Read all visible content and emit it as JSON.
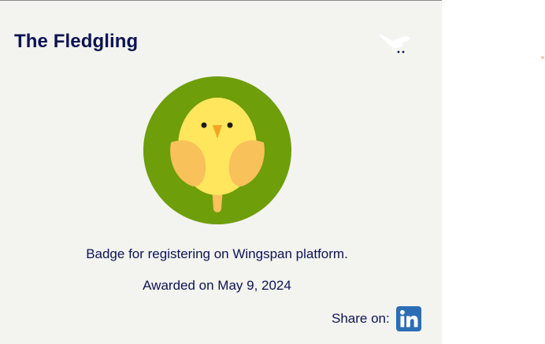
{
  "badge": {
    "title": "The Fledgling",
    "description": "Badge for registering on Wingspan platform.",
    "awarded": "Awarded on May 9, 2024",
    "share_label": "Share on:",
    "icons": {
      "close": "bird-close-icon",
      "badge": "chick-badge-icon",
      "share": "linkedin-icon"
    }
  },
  "colors": {
    "title": "#0d1452",
    "card_background": "#f3f3ef",
    "badge_ring": "#6e9e0a",
    "chick_body": "#ffe65c",
    "chick_wing": "#f9c15a",
    "linkedin": "#2d6db5"
  }
}
